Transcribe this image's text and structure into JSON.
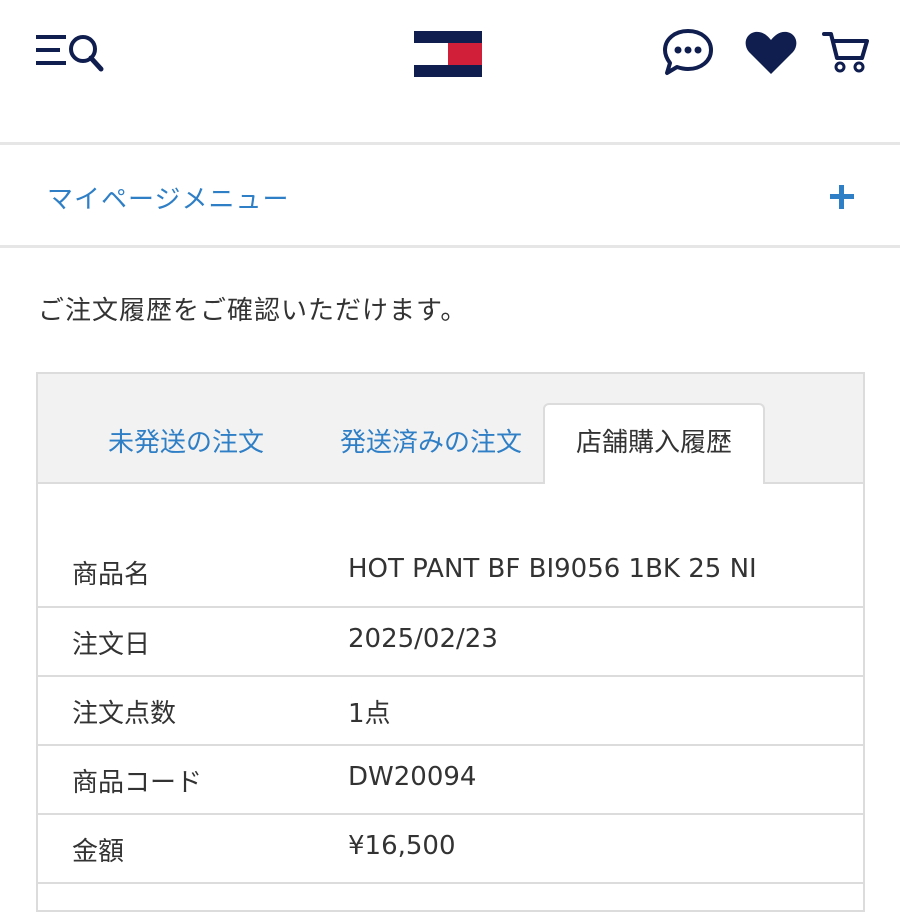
{
  "header": {
    "menu_search_icon": "menu-search-icon",
    "logo_icon": "brand-flag-logo",
    "chat_icon": "chat-icon",
    "heart_icon": "heart-icon",
    "cart_icon": "cart-icon",
    "colors": {
      "navy": "#0f1d4f",
      "red": "#d11f3a",
      "accent": "#2f7fc6"
    }
  },
  "menu": {
    "label": "マイページメニュー",
    "expand_icon": "plus-icon"
  },
  "intro_text": "ご注文履歴をご確認いただけます。",
  "tabs": [
    {
      "label": "未発送の注文"
    },
    {
      "label": "発送済みの注文"
    },
    {
      "label": "店舗購入履歴",
      "selected": true
    }
  ],
  "details": [
    {
      "label": "商品名",
      "value": "HOT PANT BF BI9056 1BK 25 NI"
    },
    {
      "label": "注文日",
      "value": "2025/02/23"
    },
    {
      "label": "注文点数",
      "value": "1点"
    },
    {
      "label": "商品コード",
      "value": "DW20094"
    },
    {
      "label": "金額",
      "value": "¥16,500"
    }
  ]
}
